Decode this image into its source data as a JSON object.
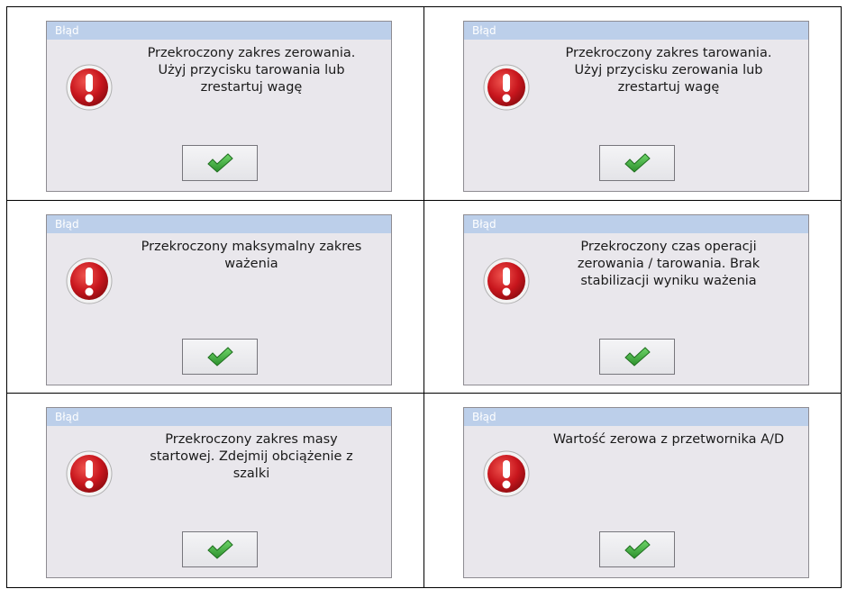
{
  "dialogs": [
    {
      "title": "Błąd",
      "message": "Przekroczony zakres zerowania.\nUżyj przycisku tarowania lub\nzrestartuj wagę"
    },
    {
      "title": "Błąd",
      "message": "Przekroczony zakres tarowania.\nUżyj przycisku zerowania lub\nzrestartuj wagę"
    },
    {
      "title": "Błąd",
      "message": "Przekroczony maksymalny zakres\nważenia"
    },
    {
      "title": "Błąd",
      "message": "Przekroczony czas operacji\nzerowania / tarowania. Brak\nstabilizacji wyniku ważenia"
    },
    {
      "title": "Błąd",
      "message": "Przekroczony zakres masy\nstartowej. Zdejmij obciążenie z\nszalki"
    },
    {
      "title": "Błąd",
      "message": "Wartość zerowa z przetwornika A/D"
    }
  ],
  "icons": {
    "error": "error-exclamation-icon",
    "ok": "checkmark-icon"
  },
  "colors": {
    "titlebar": "#bccfea",
    "dialog_bg": "#e9e7ec",
    "error_red": "#c8161d",
    "check_green": "#3aa43a"
  }
}
